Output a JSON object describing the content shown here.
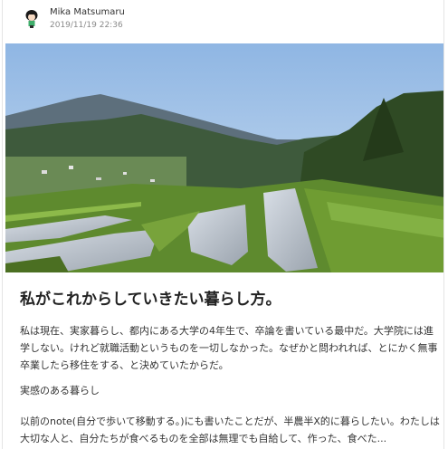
{
  "author": {
    "name": "Mika Matsumaru",
    "date": "2019/11/19 22:36"
  },
  "hero_image": {
    "alt": "terraced rice fields in a mountain valley under blue sky"
  },
  "article": {
    "title": "私がこれからしていきたい暮らし方。",
    "paragraph1": "私は現在、実家暮らし、都内にある大学の4年生で、卒論を書いている最中だ。大学院には進学しない。けれど就職活動というものを一切しなかった。なぜかと問われれば、とにかく無事卒業したら移住をする、と決めていたからだ。",
    "paragraph2": "実感のある暮らし",
    "paragraph3": "以前のnote(自分で歩いて移動する。)にも書いたことだが、半農半X的に暮らしたい。わたしは大切な人と、自分たちが食べるものを全部は無理でも自給して、作った、食べた..."
  }
}
